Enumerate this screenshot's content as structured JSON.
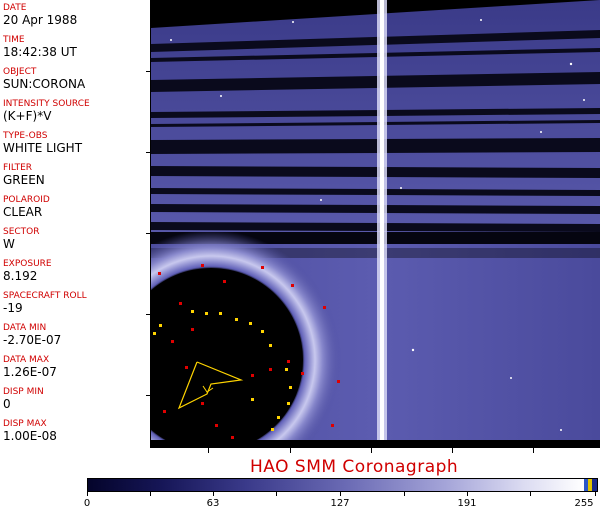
{
  "metadata": {
    "fields": [
      {
        "label": "DATE",
        "value": "20 Apr 1988"
      },
      {
        "label": "TIME",
        "value": "18:42:38 UT"
      },
      {
        "label": "OBJECT",
        "value": "SUN:CORONA"
      },
      {
        "label": "INTENSITY SOURCE",
        "value": "(K+F)*V"
      },
      {
        "label": "TYPE-OBS",
        "value": "WHITE LIGHT"
      },
      {
        "label": "FILTER",
        "value": "GREEN"
      },
      {
        "label": "POLAROID",
        "value": "CLEAR"
      },
      {
        "label": "SECTOR",
        "value": "W"
      },
      {
        "label": "EXPOSURE",
        "value": "8.192"
      },
      {
        "label": "SPACECRAFT ROLL",
        "value": "-19"
      },
      {
        "label": "DATA MIN",
        "value": "-2.70E-07"
      },
      {
        "label": "DATA MAX",
        "value": "1.26E-07"
      },
      {
        "label": "DISP MIN",
        "value": "0"
      },
      {
        "label": "DISP MAX",
        "value": "1.00E-08"
      }
    ]
  },
  "title": "HAO  SMM Coronagraph",
  "colorbar": {
    "ticks": [
      "0",
      "63",
      "127",
      "191",
      "255"
    ],
    "colors": {
      "low": "#04042a",
      "mid": "#6a6ab4",
      "high": "#ffffff",
      "end_blue": "#2b57c8",
      "end_yellow": "#e0c400"
    }
  },
  "colors": {
    "label_red": "#d00000",
    "overlay_red": "#e00000",
    "overlay_yellow": "#ffd400",
    "corona": "#4a4a9a"
  }
}
